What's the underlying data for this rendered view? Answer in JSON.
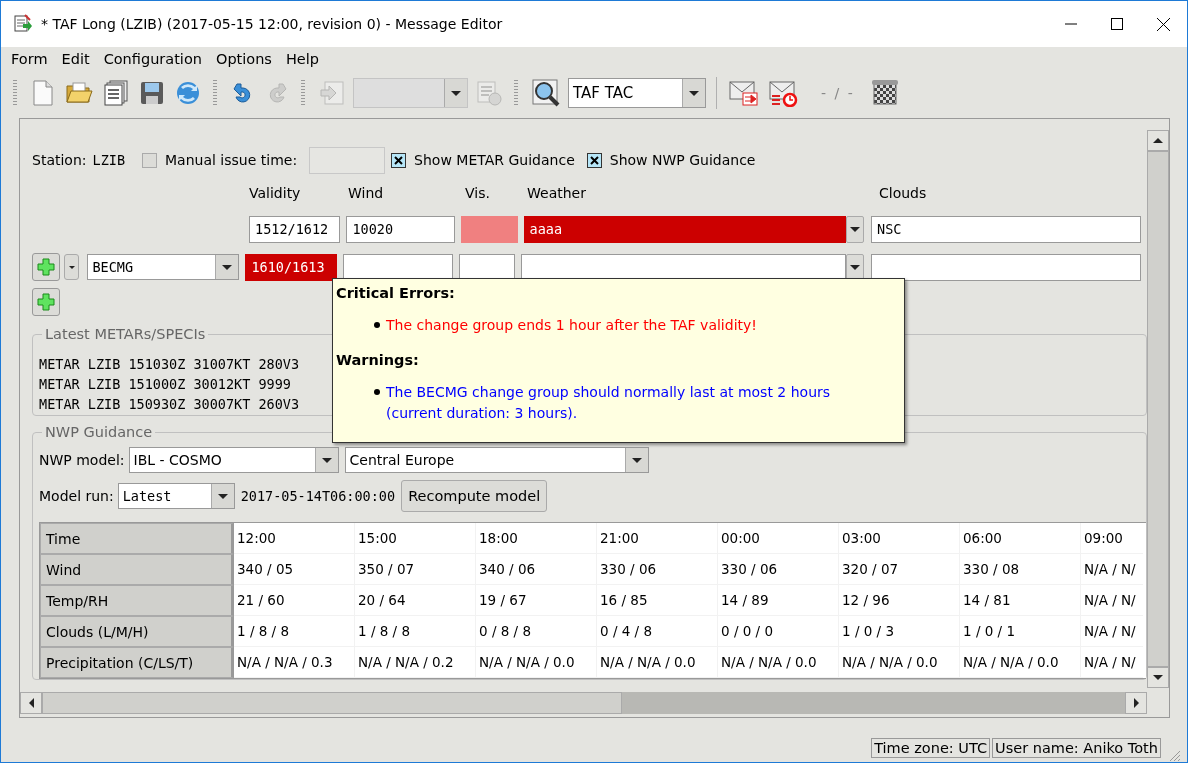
{
  "window": {
    "title": "* TAF Long (LZIB) (2017-05-15 12:00, revision 0) - Message Editor"
  },
  "menu": [
    "Form",
    "Edit",
    "Configuration",
    "Options",
    "Help"
  ],
  "toolbar": {
    "groups": [
      {
        "items": [
          {
            "kind": "button",
            "disabled": false
          },
          {
            "kind": "button",
            "disabled": false
          },
          {
            "kind": "button",
            "disabled": false
          },
          {
            "kind": "button",
            "disabled": false
          },
          {
            "kind": "button",
            "disabled": false
          }
        ]
      },
      {
        "items": [
          {
            "kind": "button",
            "disabled": false
          },
          {
            "kind": "button",
            "disabled": true
          }
        ]
      },
      {
        "items": [
          {
            "kind": "button",
            "disabled": true
          },
          {
            "kind": "combo",
            "disabled": true
          },
          {
            "kind": "button",
            "disabled": true
          }
        ]
      },
      {
        "items": [
          {
            "kind": "button",
            "disabled": false
          },
          {
            "kind": "combo",
            "disabled": false,
            "value": "TAF TAC"
          }
        ]
      },
      {
        "items": [
          {
            "kind": "button",
            "disabled": false
          },
          {
            "kind": "button",
            "disabled": false
          },
          {
            "kind": "text",
            "value": "- / -"
          },
          {
            "kind": "button",
            "disabled": false
          }
        ]
      }
    ]
  },
  "form": {
    "station_label": "Station:",
    "station": "LZIB",
    "manual_issue_time": {
      "label": "Manual issue time:",
      "checked": false
    },
    "options": [
      {
        "label": "Show METAR Guidance",
        "checked": true
      },
      {
        "label": "Show NWP Guidance",
        "checked": true
      }
    ],
    "columns": [
      "Validity",
      "Wind",
      "Vis.",
      "Weather",
      "Clouds"
    ],
    "base_row": {
      "validity": {
        "value": "1512/1612",
        "error": false
      },
      "wind": {
        "value": "10020",
        "error": false
      },
      "visibility": {
        "error": true
      },
      "weather": {
        "value": "aaaa",
        "error": true
      },
      "clouds": {
        "value": "NSC",
        "error": false
      }
    },
    "change_rows": [
      {
        "type": "BECMG",
        "validity": {
          "value": "1610/1613",
          "error": true
        }
      }
    ]
  },
  "tooltip": {
    "sections": [
      {
        "heading": "Critical Errors:",
        "kind": "error",
        "items": [
          "The change group ends 1 hour after the TAF validity!"
        ]
      },
      {
        "heading": "Warnings:",
        "kind": "warning",
        "items": [
          "The BECMG change group should normally last at most 2 hours (current duration: 3 hours)."
        ]
      }
    ]
  },
  "metars": {
    "title": "Latest METARs/SPECIs",
    "lines": [
      "METAR LZIB 151030Z 31007KT 280V3",
      "METAR LZIB 151000Z 30012KT 9999",
      "METAR LZIB 150930Z 30007KT 260V3"
    ]
  },
  "nwp": {
    "title": "NWP Guidance",
    "model_label": "NWP model:",
    "model": "IBL - COSMO",
    "region": "Central Europe",
    "run_label": "Model run:",
    "run": "Latest",
    "run_time": "2017-05-14T06:00:00",
    "recompute_button": "Recompute model",
    "table": [
      {
        "label": "Time",
        "cells": [
          "12:00",
          "15:00",
          "18:00",
          "21:00",
          "00:00",
          "03:00",
          "06:00",
          "09:00"
        ]
      },
      {
        "label": "Wind",
        "cells": [
          "340 / 05",
          "350 / 07",
          "340 / 06",
          "330 / 06",
          "330 / 06",
          "320 / 07",
          "330 / 08",
          "N/A / N/"
        ]
      },
      {
        "label": "Temp/RH",
        "cells": [
          "21 / 60",
          "20 / 64",
          "19 / 67",
          "16 / 85",
          "14 / 89",
          "12 / 96",
          "14 / 81",
          "N/A / N/"
        ]
      },
      {
        "label": "Clouds (L/M/H)",
        "cells": [
          "1 / 8 / 8",
          "1 / 8 / 8",
          "0 / 8 / 8",
          "0 / 4 / 8",
          "0 / 0 / 0",
          "1 / 0 / 3",
          "1 / 0 / 1",
          "N/A / N/"
        ]
      },
      {
        "label": "Precipitation (C/LS/T)",
        "cells": [
          "N/A / N/A / 0.3",
          "N/A / N/A / 0.2",
          "N/A / N/A / 0.0",
          "N/A / N/A / 0.0",
          "N/A / N/A / 0.0",
          "N/A / N/A / 0.0",
          "N/A / N/A / 0.0",
          "N/A / N/"
        ]
      }
    ]
  },
  "status_bar": [
    "Time zone: UTC",
    "User name: Aniko Toth"
  ]
}
